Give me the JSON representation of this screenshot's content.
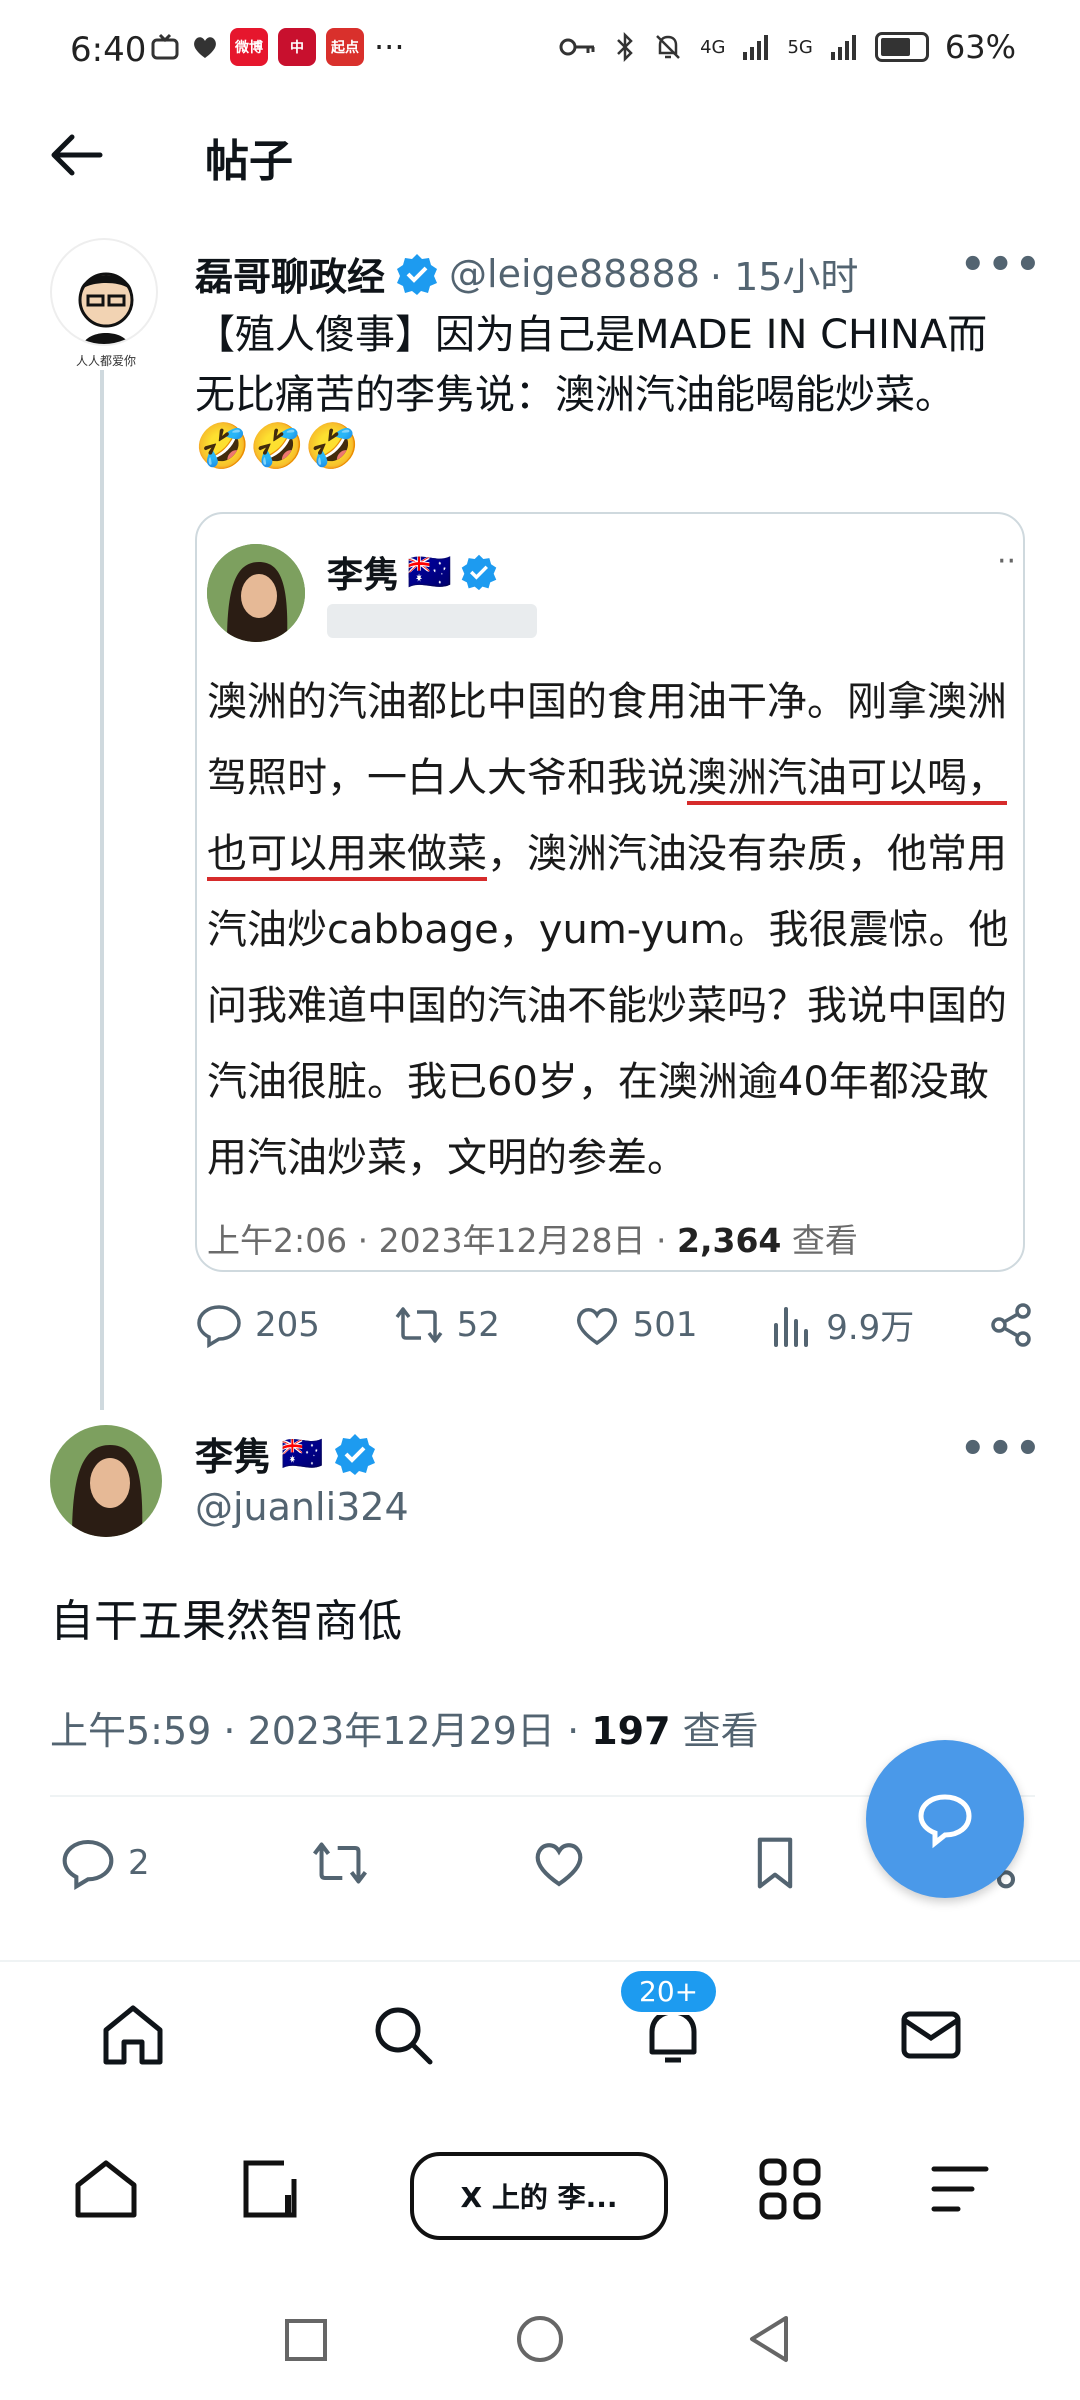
{
  "status_bar": {
    "time": "6:40",
    "dots": "···",
    "network": "4G",
    "network2": "5G",
    "battery": "63%",
    "app_badges": [
      "微博",
      "中",
      "起点"
    ]
  },
  "header": {
    "title": "帖子"
  },
  "main_tweet": {
    "author": "磊哥聊政经",
    "handle": "@leige88888",
    "time": "· 15小时",
    "text": "【殖人傻事】因为自己是MADE IN CHINA而无比痛苦的李隽说：澳洲汽油能喝能炒菜。",
    "emojis": "🤣🤣🤣",
    "avatar_text": "人人都爱你"
  },
  "quoted": {
    "name": "李隽",
    "flag": "🇦🇺",
    "text_1": "澳洲的汽油都比中国的食用油干净。刚拿澳洲驾照时，一白人大爷和我说",
    "text_underlined": "澳洲汽油可以喝，也可以用来做菜",
    "text_2": "，澳洲汽油没有杂质，他常用汽油炒cabbage，yum-yum。我很震惊。他问我难道中国的汽油不能炒菜吗？我说中国的汽油很脏。我已60岁，在澳洲逾40年都没敢用汽油炒菜，文明的参差。",
    "time": "上午2:06 · 2023年12月28日 · ",
    "views_count": "2,364",
    "views_label": " 查看"
  },
  "actions": {
    "replies": "205",
    "retweets": "52",
    "likes": "501",
    "views": "9.9万"
  },
  "reply": {
    "name": "李隽",
    "flag": "🇦🇺",
    "handle": "@juanli324",
    "text": "自干五果然智商低",
    "time": "上午5:59 · 2023年12月29日 · ",
    "views_count": "197",
    "views_label": " 查看",
    "replies": "2"
  },
  "bottom_nav": {
    "notif_badge": "20+"
  },
  "browser": {
    "tab_label": "X 上的 李..."
  }
}
